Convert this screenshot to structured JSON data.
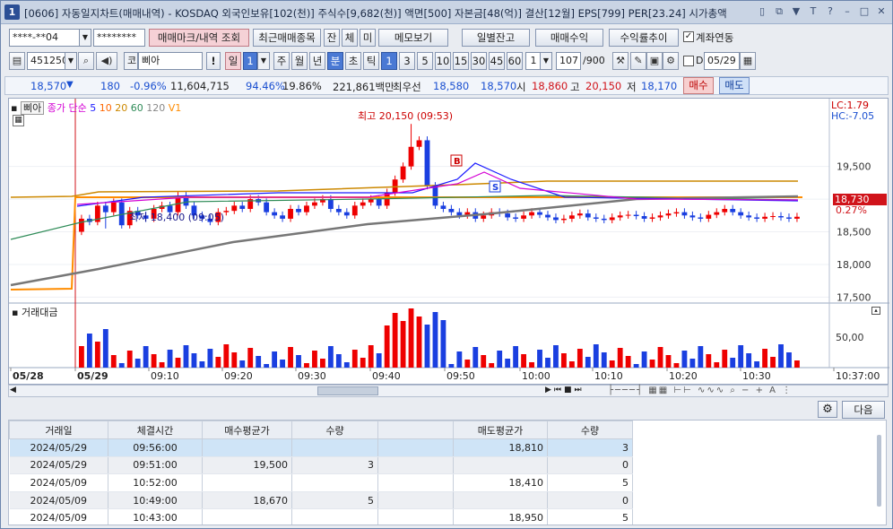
{
  "window": {
    "number": "1",
    "title": "[0606] 자동일지차트(매매내역) - KOSDAQ 외국인보유[102(천)] 주식수[9,682(천)] 액면[500] 자본금[48(억)] 결산[12월] EPS[799] PER[23.24] 시가총액",
    "controls": [
      "▯",
      "⧉",
      "▼",
      "T",
      "?",
      "–",
      "□",
      "✕"
    ]
  },
  "toolbar1": {
    "account": "****-**04",
    "password": "********",
    "buttons": [
      "매매마크/내역 조회",
      "최근매매종목",
      "잔",
      "체",
      "미",
      "메모보기",
      "일별잔고",
      "매매수익",
      "수익률추이"
    ],
    "checkbox_label": "계좌연동"
  },
  "toolbar2": {
    "code": "451250",
    "market": "코",
    "name": "삐아",
    "bang": "!",
    "period_label": "일",
    "period_num": "1",
    "periods": [
      "주",
      "월",
      "년",
      "분",
      "초",
      "틱"
    ],
    "intervals": [
      "1",
      "3",
      "5",
      "10",
      "15",
      "30",
      "45",
      "60"
    ],
    "count": "1",
    "range": "107",
    "range_max": "/900",
    "check_d": "D",
    "date": "05/29"
  },
  "quote": {
    "price": "18,570",
    "arrow": "▼",
    "change": "180",
    "pct": "-0.96%",
    "volume": "11,604,715",
    "ratio1": "94.46%",
    "ratio2": "19.86%",
    "amount": "221,861백만",
    "best_label": "최우선",
    "bid": "18,580",
    "ask": "18,570",
    "open_label": "시",
    "open": "18,860",
    "high_label": "고",
    "high": "20,150",
    "low_label": "저",
    "low": "18,170",
    "buy": "매수",
    "sell": "매도"
  },
  "chart": {
    "legend_name": "삐아",
    "legend_items": [
      "종가 단순",
      "5",
      "10",
      "20",
      "60",
      "120",
      "V1"
    ],
    "legend_colors": [
      "#d400d4",
      "#1a1aff",
      "#ff6600",
      "#cc8800",
      "#2e8b57",
      "#888888",
      "#ff8c00"
    ],
    "high_note": "최고 20,150 (09:53)",
    "low_note": "최저 18,400 (09:05)",
    "lc": "LC:1.79",
    "hc": "HC:-7.05",
    "price_tag": "18,730",
    "pct_tag": "0.27%",
    "y_ticks": [
      "19,500",
      "19,000",
      "18,500",
      "18,000",
      "17,500"
    ],
    "vol_label": "거래대금",
    "vol_tick": "50,00",
    "x_labels": [
      "05/28",
      "05/29",
      "09:10",
      "09:20",
      "09:30",
      "09:40",
      "09:50",
      "10:00",
      "10:10",
      "10:20",
      "10:30",
      "10:37:00"
    ],
    "marker_b": "B",
    "marker_s": "S"
  },
  "chart_data": {
    "type": "candlestick",
    "title": "",
    "ylim": [
      17300,
      20400
    ],
    "x": [
      "05/28",
      "05/29 09:00",
      "09:10",
      "09:20",
      "09:30",
      "09:40",
      "09:50",
      "10:00",
      "10:10",
      "10:20",
      "10:30"
    ],
    "close": [
      18460,
      18700,
      18900,
      18750,
      18700,
      18800,
      19900,
      18900,
      18750,
      18780,
      18730
    ],
    "high": 20150,
    "low": 18400
  },
  "bottom": {
    "gear": "⚙",
    "next": "다음",
    "columns": [
      "거래일",
      "체결시간",
      "매수평균가",
      "수량",
      "",
      "매도평균가",
      "수량"
    ],
    "rows": [
      [
        "2024/05/29",
        "09:56:00",
        "",
        "",
        "",
        "18,810",
        "3"
      ],
      [
        "2024/05/29",
        "09:51:00",
        "19,500",
        "3",
        "",
        "",
        "0"
      ],
      [
        "2024/05/09",
        "10:52:00",
        "",
        "",
        "",
        "18,410",
        "5"
      ],
      [
        "2024/05/09",
        "10:49:00",
        "18,670",
        "5",
        "",
        "",
        "0"
      ],
      [
        "2024/05/09",
        "10:43:00",
        "",
        "",
        "",
        "18,950",
        "5"
      ]
    ]
  }
}
